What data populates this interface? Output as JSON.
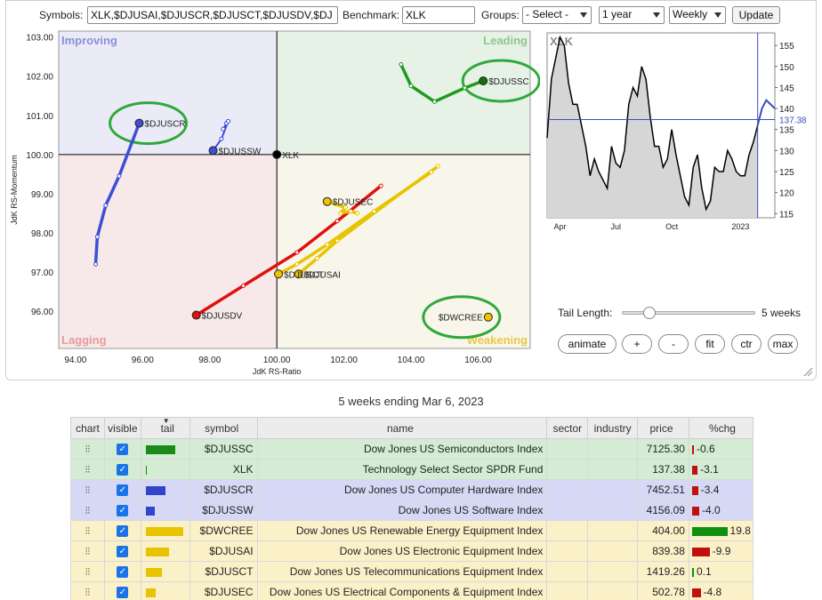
{
  "controls": {
    "symbols_label": "Symbols:",
    "symbols_value": "XLK,$DJUSAI,$DJUSCR,$DJUSCT,$DJUSDV,$DJ",
    "benchmark_label": "Benchmark:",
    "benchmark_value": "XLK",
    "groups_label": "Groups:",
    "groups_value": "- Select -",
    "period_value": "1 year",
    "frequency_value": "Weekly",
    "update_label": "Update"
  },
  "rrg": {
    "quadrants": {
      "improving": "Improving",
      "leading": "Leading",
      "lagging": "Lagging",
      "weakening": "Weakening"
    },
    "colors": {
      "improving_bg": "#ebebf8",
      "leading_bg": "#e6f2e6",
      "lagging_bg": "#f7e9e9",
      "weakening_bg": "#f8f6ea",
      "improving_text": "#8a90d8",
      "leading_text": "#8cc88c",
      "lagging_text": "#e79a9a",
      "weakening_text": "#e8c84a"
    },
    "x_axis_label": "JdK RS-Ratio",
    "y_axis_label": "JdK RS-Momentum",
    "x_ticks": [
      "94.00",
      "96.00",
      "98.00",
      "100.00",
      "102.00",
      "104.00",
      "106.00"
    ],
    "y_ticks": [
      "103.00",
      "102.00",
      "101.00",
      "100.00",
      "99.00",
      "98.00",
      "97.00",
      "96.00"
    ],
    "series": [
      {
        "symbol": "$DJUSSC",
        "color": "#1f9a1f",
        "head": "#107010",
        "tail": [
          [
            103.7,
            102.3
          ],
          [
            104.0,
            101.75
          ],
          [
            104.7,
            101.35
          ],
          [
            105.6,
            101.7
          ],
          [
            106.15,
            101.88
          ]
        ]
      },
      {
        "symbol": "$DJUSCR",
        "color": "#3c4fd6",
        "head": "#3c4fd6",
        "tail": [
          [
            94.6,
            97.2
          ],
          [
            94.65,
            97.9
          ],
          [
            94.9,
            98.7
          ],
          [
            95.3,
            99.45
          ],
          [
            95.9,
            100.8
          ]
        ]
      },
      {
        "symbol": "$DJUSSW",
        "color": "#3c4fd6",
        "head": "#3c4fd6",
        "tail": [
          [
            98.5,
            100.8
          ],
          [
            98.4,
            100.65
          ],
          [
            98.55,
            100.85
          ],
          [
            98.35,
            100.4
          ],
          [
            98.1,
            100.1
          ]
        ]
      },
      {
        "symbol": "XLK",
        "color": "#000000",
        "head": "#000000",
        "tail": [
          [
            100.0,
            100.0
          ]
        ]
      },
      {
        "symbol": "$DJUSDV",
        "color": "#e01010",
        "head": "#e01010",
        "tail": [
          [
            103.1,
            99.2
          ],
          [
            101.8,
            98.3
          ],
          [
            100.6,
            97.5
          ],
          [
            99.0,
            96.65
          ],
          [
            97.6,
            95.9
          ]
        ]
      },
      {
        "symbol": "$DWCREE",
        "color": "#e8c300",
        "head": "#f0c200",
        "tail": [
          [
            106.3,
            95.85
          ]
        ]
      },
      {
        "symbol": "$DJUSAI",
        "color": "#e8c300",
        "head": "#f0c200",
        "tail": [
          [
            104.8,
            99.7
          ],
          [
            103.2,
            98.7
          ],
          [
            101.8,
            97.8
          ],
          [
            101.2,
            97.35
          ],
          [
            100.65,
            96.95
          ]
        ]
      },
      {
        "symbol": "$DJUSCT",
        "color": "#e8c300",
        "head": "#f0c200",
        "tail": [
          [
            104.6,
            99.55
          ],
          [
            102.9,
            98.55
          ],
          [
            101.5,
            97.7
          ],
          [
            100.6,
            97.2
          ],
          [
            100.05,
            96.95
          ]
        ]
      },
      {
        "symbol": "$DJUSEC",
        "color": "#e8c300",
        "head": "#f0c200",
        "tail": [
          [
            102.4,
            98.5
          ],
          [
            102.2,
            98.55
          ],
          [
            101.9,
            98.5
          ],
          [
            102.05,
            98.65
          ],
          [
            101.5,
            98.8
          ]
        ]
      }
    ]
  },
  "price_chart": {
    "title": "XLK",
    "x_ticks": [
      "Apr",
      "Jul",
      "Oct",
      "2023"
    ],
    "y_ticks": [
      "155",
      "150",
      "145",
      "140",
      "135",
      "130",
      "125",
      "120",
      "115"
    ],
    "current_price_label": "137.38",
    "line_color": "#000000",
    "highlight_color": "#3b4cc0",
    "values": [
      133,
      147,
      152,
      157,
      155,
      146,
      141,
      141,
      136,
      131,
      124,
      128,
      125,
      123,
      121,
      131,
      127,
      126,
      130,
      141,
      145,
      143,
      150,
      147,
      138,
      131,
      131,
      126,
      128,
      135,
      129,
      124,
      119,
      117,
      126,
      129,
      121,
      116,
      118,
      126,
      125,
      125,
      130,
      128,
      125,
      124,
      124,
      129,
      132,
      136,
      140,
      142,
      141,
      140
    ]
  },
  "tail_control": {
    "label": "Tail Length:",
    "value_label": "5 weeks",
    "value": 0.2
  },
  "playback": {
    "animate": "animate",
    "plus": "+",
    "minus": "-",
    "fit": "fit",
    "ctr": "ctr",
    "max": "max"
  },
  "period_text": "5 weeks ending Mar 6, 2023",
  "table": {
    "headers": {
      "chart": "chart",
      "visible": "visible",
      "tail": "tail",
      "symbol": "symbol",
      "name": "name",
      "sector": "sector",
      "industry": "industry",
      "price": "price",
      "chg": "%chg"
    },
    "rows": [
      {
        "group": "green",
        "symbol": "$DJUSSC",
        "name": "Dow Jones US Semiconductors Index",
        "price": "7125.30",
        "chg": "-0.6",
        "chg_value": -0.6,
        "tail_color": "#1a8a1a",
        "tail_len": 33
      },
      {
        "group": "green",
        "symbol": "XLK",
        "name": "Technology Select Sector SPDR Fund",
        "price": "137.38",
        "chg": "-3.1",
        "chg_value": -3.1,
        "tail_color": "#1a8a1a",
        "tail_len": 1
      },
      {
        "group": "blue",
        "symbol": "$DJUSCR",
        "name": "Dow Jones US Computer Hardware Index",
        "price": "7452.51",
        "chg": "-3.4",
        "chg_value": -3.4,
        "tail_color": "#3344cc",
        "tail_len": 22
      },
      {
        "group": "blue",
        "symbol": "$DJUSSW",
        "name": "Dow Jones US Software Index",
        "price": "4156.09",
        "chg": "-4.0",
        "chg_value": -4.0,
        "tail_color": "#3344cc",
        "tail_len": 10
      },
      {
        "group": "yellow",
        "symbol": "$DWCREE",
        "name": "Dow Jones US Renewable Energy Equipment Index",
        "price": "404.00",
        "chg": "19.8",
        "chg_value": 19.8,
        "tail_color": "#e8c300",
        "tail_len": 42
      },
      {
        "group": "yellow",
        "symbol": "$DJUSAI",
        "name": "Dow Jones US Electronic Equipment Index",
        "price": "839.38",
        "chg": "-9.9",
        "chg_value": -9.9,
        "tail_color": "#e8c300",
        "tail_len": 26
      },
      {
        "group": "yellow",
        "symbol": "$DJUSCT",
        "name": "Dow Jones US Telecommunications Equipment Index",
        "price": "1419.26",
        "chg": "0.1",
        "chg_value": 0.1,
        "tail_color": "#e8c300",
        "tail_len": 18
      },
      {
        "group": "yellow",
        "symbol": "$DJUSEC",
        "name": "Dow Jones US Electrical Components & Equipment Index",
        "price": "502.78",
        "chg": "-4.8",
        "chg_value": -4.8,
        "tail_color": "#e8c300",
        "tail_len": 11
      }
    ],
    "chart_icon": "chart-link-icon",
    "check_icon": "checkbox-checked-icon"
  }
}
